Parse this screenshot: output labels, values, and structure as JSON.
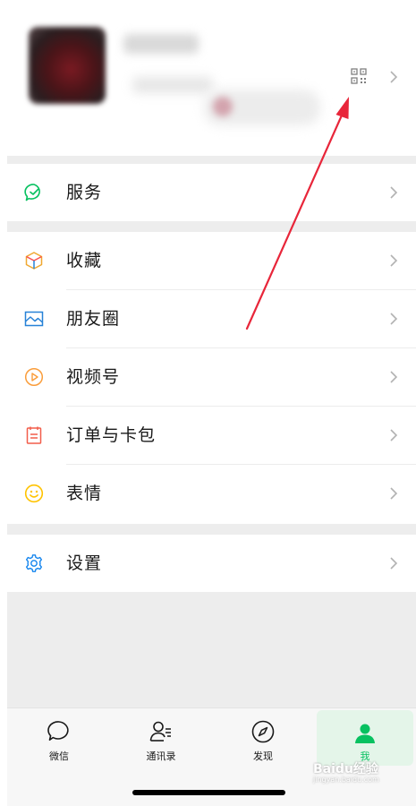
{
  "profile": {
    "qr_icon": "qr-code-icon",
    "chevron_icon": "chevron-right-icon"
  },
  "menu": {
    "services": {
      "label": "服务",
      "icon": "services-icon",
      "color": "#07c160"
    },
    "favorites": {
      "label": "收藏",
      "icon": "cube-icon",
      "color": "#f0a830"
    },
    "moments": {
      "label": "朋友圈",
      "icon": "image-icon",
      "color": "#2782d7"
    },
    "channels": {
      "label": "视频号",
      "icon": "play-circle-icon",
      "color": "#fa9d3b"
    },
    "orders": {
      "label": "订单与卡包",
      "icon": "ticket-icon",
      "color": "#f25d4a"
    },
    "stickers": {
      "label": "表情",
      "icon": "smiley-icon",
      "color": "#ffc300"
    },
    "settings": {
      "label": "设置",
      "icon": "gear-icon",
      "color": "#1485ee"
    }
  },
  "tabbar": {
    "chats": "微信",
    "contacts": "通讯录",
    "discover": "发现",
    "me": "我",
    "active": "me",
    "accent": "#07c160"
  },
  "watermark": {
    "main": "Baidu经验",
    "sub": "jingyan.baidu.com"
  }
}
